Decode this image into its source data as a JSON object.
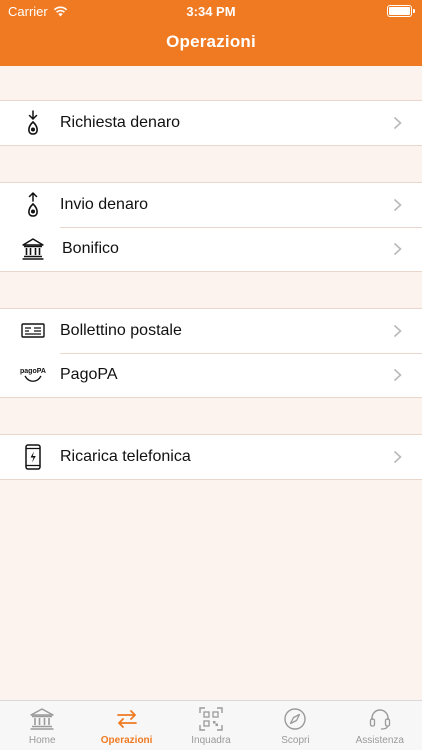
{
  "status_bar": {
    "carrier": "Carrier",
    "time": "3:34 PM"
  },
  "header": {
    "title": "Operazioni"
  },
  "groups": [
    {
      "items": [
        {
          "label": "Richiesta denaro",
          "icon": "request-money-icon"
        }
      ]
    },
    {
      "items": [
        {
          "label": "Invio denaro",
          "icon": "send-money-icon"
        },
        {
          "label": "Bonifico",
          "icon": "bank-transfer-icon"
        }
      ]
    },
    {
      "items": [
        {
          "label": "Bollettino postale",
          "icon": "postal-bill-icon"
        },
        {
          "label": "PagoPA",
          "icon": "pagopa-icon"
        }
      ]
    },
    {
      "items": [
        {
          "label": "Ricarica telefonica",
          "icon": "phone-recharge-icon"
        }
      ]
    }
  ],
  "tabbar": {
    "active": "Operazioni",
    "tabs": [
      {
        "label": "Home",
        "icon": "bank-icon"
      },
      {
        "label": "Operazioni",
        "icon": "transfer-arrows-icon"
      },
      {
        "label": "Inquadra",
        "icon": "qr-code-icon"
      },
      {
        "label": "Scopri",
        "icon": "compass-icon"
      },
      {
        "label": "Assistenza",
        "icon": "headset-icon"
      }
    ]
  },
  "colors": {
    "accent": "#f07a22",
    "background": "#fdf3ee"
  }
}
